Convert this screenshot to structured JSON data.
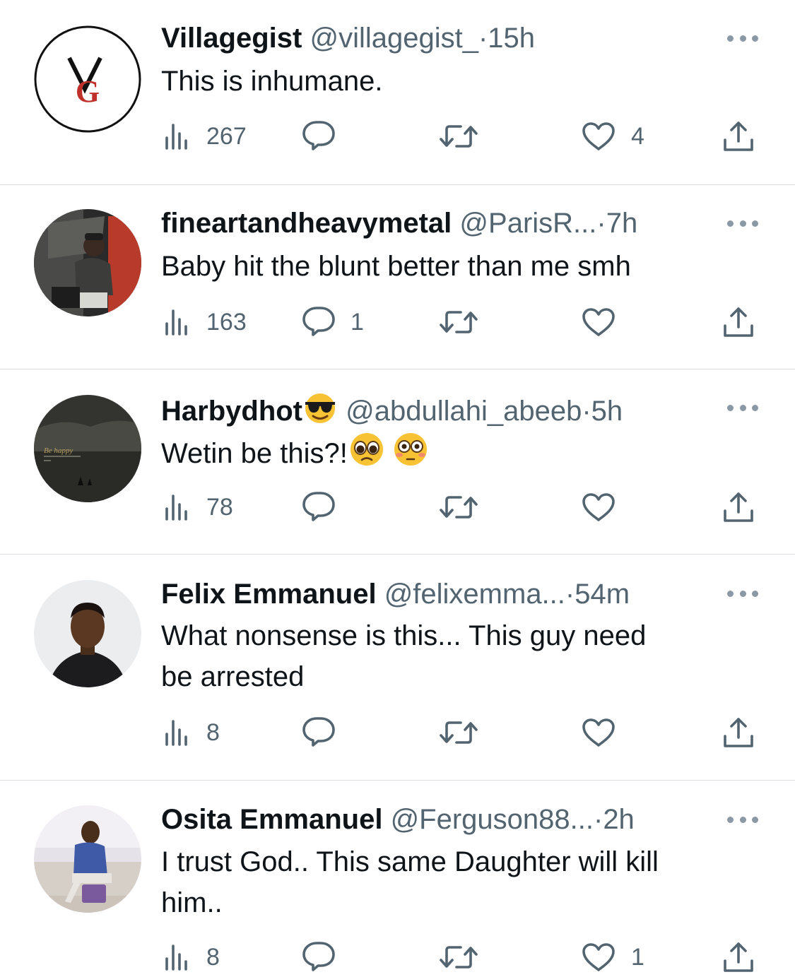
{
  "replies": [
    {
      "name": "Villagegist",
      "handle": "@villagegist_",
      "time": "15h",
      "text": "This is inhumane.",
      "avatar": "vg-logo",
      "views": "267",
      "replies_count": "",
      "likes": "4"
    },
    {
      "name": "fineartandheavymetal",
      "handle": "@ParisR...",
      "time": "7h",
      "text": "Baby hit the blunt better than me smh",
      "avatar": "photo-man-car",
      "views": "163",
      "replies_count": "1",
      "likes": ""
    },
    {
      "name": "Harbydhot",
      "name_emoji": "smiling-face-with-sunglasses-emoji",
      "handle": "@abdullahi_abeeb",
      "time": "5h",
      "text": "Wetin be this?!",
      "text_emojis": [
        "pleading-face-emoji",
        "flushed-face-emoji"
      ],
      "avatar": "dark-landscape-photo",
      "avatar_caption": "Be happy",
      "views": "78",
      "replies_count": "",
      "likes": ""
    },
    {
      "name": "Felix Emmanuel",
      "handle": "@felixemma...",
      "time": "54m",
      "text_lines": [
        "What nonsense is this... This guy need",
        "be arrested"
      ],
      "avatar": "photo-man-portrait",
      "views": "8",
      "replies_count": "",
      "likes": ""
    },
    {
      "name": "Osita Emmanuel",
      "handle": "@Ferguson88...",
      "time": "2h",
      "text_lines": [
        "I trust God.. This same Daughter will kill",
        "him.."
      ],
      "avatar": "photo-man-sofa",
      "views": "8",
      "replies_count": "",
      "likes": "1"
    }
  ],
  "separator": "·",
  "icons": {
    "views": "views-icon",
    "reply": "reply-icon",
    "retweet": "retweet-icon",
    "like": "like-icon",
    "share": "share-icon",
    "more": "more-icon"
  },
  "colors": {
    "text": "#0f1419",
    "secondary": "#536471",
    "divider": "#d9dde1"
  }
}
